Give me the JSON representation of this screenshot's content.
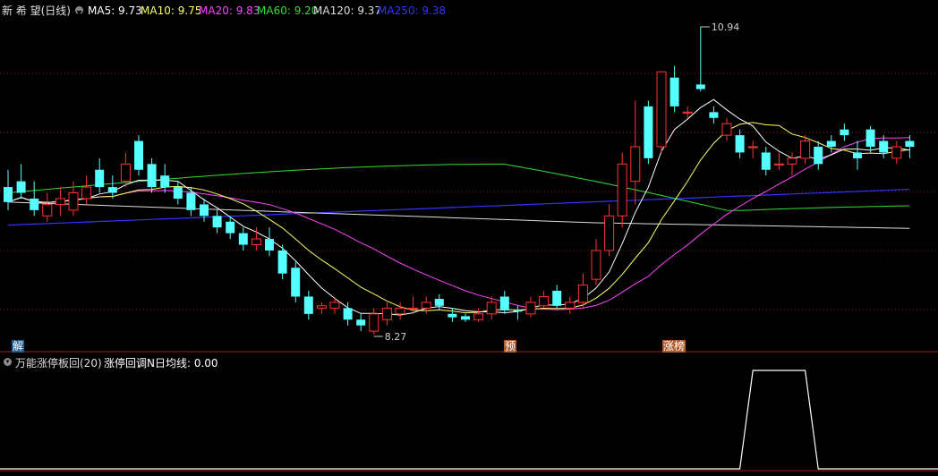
{
  "header": {
    "stock_name": "新 希 望(日线)",
    "ma_items": [
      {
        "label": "MA5: 9.73",
        "color": "#ffffff"
      },
      {
        "label": "MA10: 9.75",
        "color": "#ffff66"
      },
      {
        "label": "MA20: 9.83",
        "color": "#ff44ff"
      },
      {
        "label": "MA60: 9.20",
        "color": "#33dd33"
      },
      {
        "label": "MA120: 9.37",
        "color": "#dddddd"
      },
      {
        "label": "MA250: 9.38",
        "color": "#3333ff"
      }
    ]
  },
  "markers": {
    "jie": "解",
    "yu": "预",
    "zhangbang": "涨榜"
  },
  "indicator": {
    "title": "万能涨停板回(20)",
    "value_label": "涨停回调N日均线: 0.00"
  },
  "colors": {
    "up": "#ff3333",
    "down": "#55ffff",
    "grid": "#8b1a1a",
    "background": "#000000"
  },
  "chart_data": {
    "type": "candlestick",
    "price_annotations": {
      "high": "10.94",
      "low": "8.27"
    },
    "candles": [
      [
        9.55,
        9.42,
        9.7,
        9.35
      ],
      [
        9.6,
        9.5,
        9.75,
        9.45
      ],
      [
        9.45,
        9.35,
        9.6,
        9.3
      ],
      [
        9.3,
        9.4,
        9.5,
        9.25
      ],
      [
        9.4,
        9.45,
        9.55,
        9.3
      ],
      [
        9.35,
        9.5,
        9.6,
        9.3
      ],
      [
        9.45,
        9.55,
        9.65,
        9.4
      ],
      [
        9.7,
        9.55,
        9.8,
        9.5
      ],
      [
        9.55,
        9.5,
        9.65,
        9.45
      ],
      [
        9.6,
        9.75,
        9.85,
        9.55
      ],
      [
        9.95,
        9.7,
        10.0,
        9.65
      ],
      [
        9.75,
        9.55,
        9.8,
        9.5
      ],
      [
        9.65,
        9.55,
        9.75,
        9.5
      ],
      [
        9.55,
        9.45,
        9.6,
        9.4
      ],
      [
        9.5,
        9.35,
        9.55,
        9.3
      ],
      [
        9.4,
        9.3,
        9.45,
        9.25
      ],
      [
        9.3,
        9.2,
        9.35,
        9.15
      ],
      [
        9.25,
        9.15,
        9.3,
        9.1
      ],
      [
        9.15,
        9.05,
        9.2,
        9.0
      ],
      [
        9.05,
        9.1,
        9.2,
        9.0
      ],
      [
        9.1,
        9.0,
        9.2,
        8.95
      ],
      [
        9.0,
        8.8,
        9.05,
        8.75
      ],
      [
        8.85,
        8.6,
        8.9,
        8.55
      ],
      [
        8.6,
        8.45,
        8.65,
        8.4
      ],
      [
        8.5,
        8.52,
        8.55,
        8.45
      ],
      [
        8.5,
        8.55,
        8.6,
        8.45
      ],
      [
        8.5,
        8.4,
        8.55,
        8.35
      ],
      [
        8.4,
        8.35,
        8.45,
        8.3
      ],
      [
        8.3,
        8.45,
        8.5,
        8.27
      ],
      [
        8.4,
        8.5,
        8.55,
        8.35
      ],
      [
        8.45,
        8.5,
        8.55,
        8.4
      ],
      [
        8.5,
        8.5,
        8.6,
        8.45
      ],
      [
        8.5,
        8.55,
        8.6,
        8.45
      ],
      [
        8.58,
        8.52,
        8.62,
        8.48
      ],
      [
        8.45,
        8.42,
        8.5,
        8.38
      ],
      [
        8.43,
        8.4,
        8.45,
        8.38
      ],
      [
        8.4,
        8.45,
        8.5,
        8.38
      ],
      [
        8.45,
        8.55,
        8.6,
        8.4
      ],
      [
        8.6,
        8.48,
        8.65,
        8.45
      ],
      [
        8.48,
        8.47,
        8.52,
        8.4
      ],
      [
        8.45,
        8.55,
        8.6,
        8.42
      ],
      [
        8.52,
        8.6,
        8.65,
        8.5
      ],
      [
        8.65,
        8.52,
        8.7,
        8.5
      ],
      [
        8.5,
        8.55,
        8.6,
        8.45
      ],
      [
        8.55,
        8.7,
        8.8,
        8.5
      ],
      [
        8.75,
        9.0,
        9.1,
        8.7
      ],
      [
        9.0,
        9.3,
        9.4,
        8.95
      ],
      [
        9.3,
        9.75,
        9.85,
        9.2
      ],
      [
        9.6,
        9.9,
        10.3,
        9.4
      ],
      [
        10.25,
        9.8,
        10.3,
        9.75
      ],
      [
        9.9,
        10.55,
        10.55,
        9.85
      ],
      [
        10.5,
        10.25,
        10.6,
        10.2
      ],
      [
        10.2,
        10.2,
        10.25,
        10.15
      ],
      [
        10.44,
        10.4,
        10.94,
        10.38
      ],
      [
        10.2,
        10.15,
        10.25,
        10.1
      ],
      [
        10.0,
        10.1,
        10.15,
        9.95
      ],
      [
        10.0,
        9.85,
        10.05,
        9.8
      ],
      [
        9.9,
        9.9,
        9.95,
        9.8
      ],
      [
        9.85,
        9.7,
        9.9,
        9.65
      ],
      [
        9.75,
        9.75,
        9.85,
        9.7
      ],
      [
        9.75,
        9.8,
        9.85,
        9.65
      ],
      [
        9.8,
        9.95,
        10.0,
        9.75
      ],
      [
        9.9,
        9.75,
        9.95,
        9.7
      ],
      [
        9.95,
        9.9,
        10.0,
        9.85
      ],
      [
        10.05,
        10.0,
        10.1,
        9.95
      ],
      [
        9.85,
        9.8,
        9.95,
        9.7
      ],
      [
        10.05,
        9.9,
        10.08,
        9.85
      ],
      [
        9.95,
        9.85,
        10.0,
        9.8
      ],
      [
        9.8,
        9.9,
        9.95,
        9.75
      ],
      [
        9.95,
        9.9,
        10.0,
        9.8
      ]
    ],
    "indicator_ylim": [
      0,
      1
    ]
  }
}
